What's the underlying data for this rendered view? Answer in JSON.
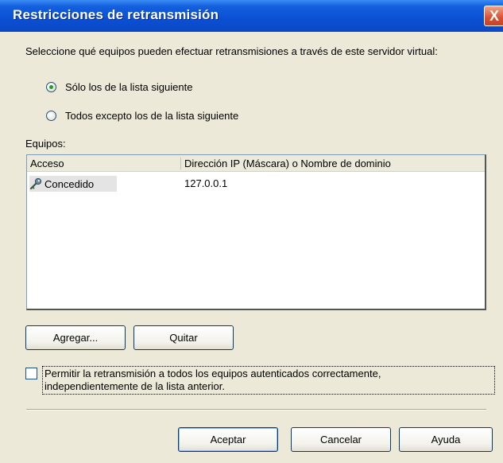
{
  "window": {
    "title": "Restricciones de retransmisión",
    "close_glyph": "X"
  },
  "description": "Seleccione qué equipos pueden efectuar retransmisiones a través de este servidor virtual:",
  "radio_options": [
    {
      "label": "Sólo los de la lista siguiente",
      "checked": true
    },
    {
      "label": "Todos excepto los de la lista siguiente",
      "checked": false
    }
  ],
  "list": {
    "label": "Equipos:",
    "columns": [
      "Acceso",
      "Dirección IP (Máscara) o Nombre de dominio"
    ],
    "rows": [
      {
        "access": "Concedido",
        "address": "127.0.0.1",
        "icon": "key-icon"
      }
    ]
  },
  "list_buttons": {
    "add": "Agregar...",
    "remove": "Quitar"
  },
  "checkbox": {
    "line1": "Permitir la retransmisión a todos los equipos autenticados correctamente,",
    "line2": "independientemente de la lista anterior.",
    "checked": false
  },
  "footer_buttons": {
    "ok": "Aceptar",
    "cancel": "Cancelar",
    "help": "Ayuda"
  }
}
